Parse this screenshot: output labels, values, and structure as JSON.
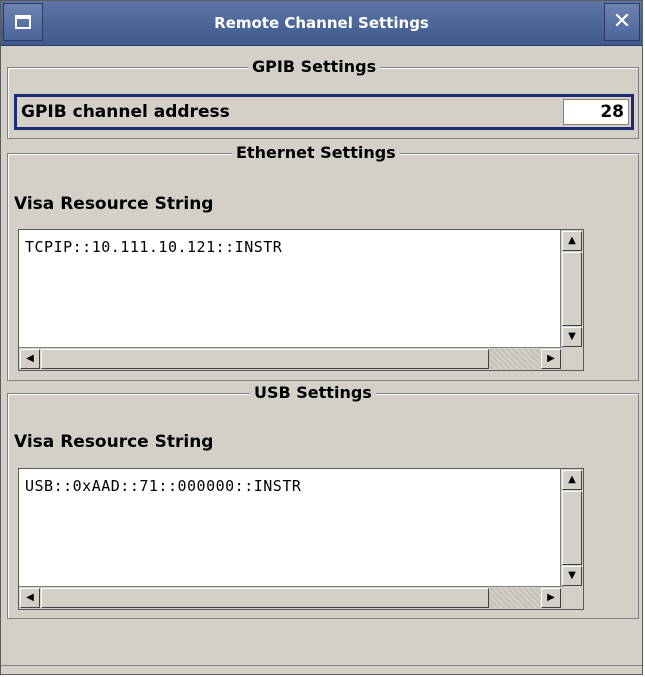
{
  "window": {
    "title": "Remote Channel Settings",
    "close_glyph": "✕"
  },
  "gpib": {
    "legend": "GPIB Settings",
    "address_label": "GPIB channel address",
    "address_value": "28"
  },
  "ethernet": {
    "legend": "Ethernet Settings",
    "resource_label": "Visa Resource String",
    "resource_value": "TCPIP::10.111.10.121::INSTR"
  },
  "usb": {
    "legend": "USB Settings",
    "resource_label": "Visa Resource String",
    "resource_value": "USB::0xAAD::71::000000::INSTR"
  },
  "icons": {
    "window_menu": "window-menu-icon",
    "close": "close-icon",
    "scroll_up": "▲",
    "scroll_down": "▼",
    "scroll_left": "◀",
    "scroll_right": "▶"
  },
  "colors": {
    "titlebar": "#4b659a",
    "dialog_bg": "#d4d0c8",
    "focus_border": "#1d2a7a"
  }
}
